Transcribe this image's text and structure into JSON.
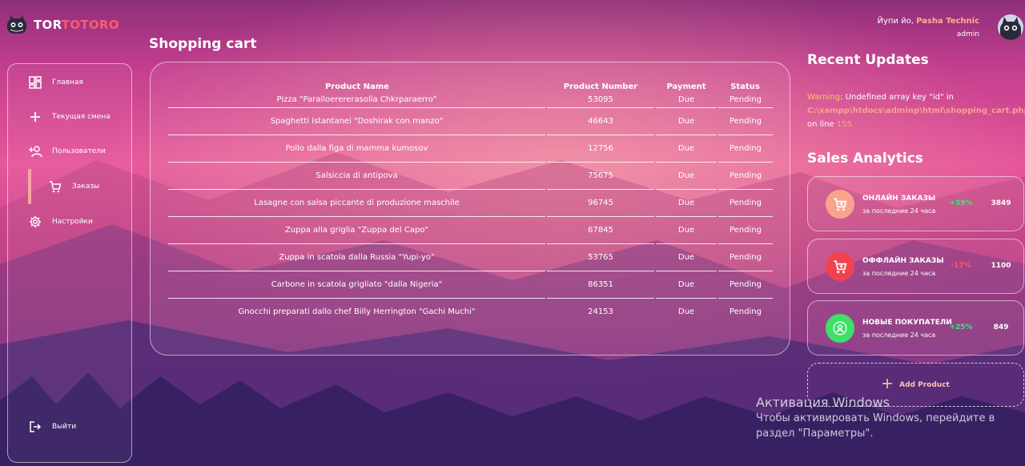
{
  "brand": {
    "part1": "TOR",
    "part2": "TOTORO"
  },
  "sidebar": {
    "items": [
      {
        "label": "Главная",
        "icon": "dashboard-icon"
      },
      {
        "label": "Текущая смена",
        "icon": "plus-icon"
      },
      {
        "label": "Пользователи",
        "icon": "person-add-icon"
      },
      {
        "label": "Заказы",
        "icon": "cart-icon",
        "active": true
      },
      {
        "label": "Настройки",
        "icon": "gear-icon"
      }
    ],
    "logout": "Выйти"
  },
  "main": {
    "title": "Shopping cart",
    "table": {
      "headers": [
        "Product Name",
        "Product Number",
        "Payment",
        "Status"
      ],
      "rows": [
        [
          "Pizza \"Paralloerererasolla Chkrparaerro\"",
          "53095",
          "Due",
          "Pending"
        ],
        [
          "Spaghetti istantanei \"Doshirak con manzo\"",
          "46643",
          "Due",
          "Pending"
        ],
        [
          "Pollo dalla figa di mamma kumosov",
          "12756",
          "Due",
          "Pending"
        ],
        [
          "Salsiccia di antipova",
          "75675",
          "Due",
          "Pending"
        ],
        [
          "Lasagne con salsa piccante di produzione maschile",
          "96745",
          "Due",
          "Pending"
        ],
        [
          "Zuppa alla griglia \"Zuppa del Capo\"",
          "67845",
          "Due",
          "Pending"
        ],
        [
          "Zuppa in scatola dalla Russia \"Yupi-yo\"",
          "53765",
          "Due",
          "Pending"
        ],
        [
          "Carbone in scatola grigliato \"dalla Nigeria\"",
          "86351",
          "Due",
          "Pending"
        ],
        [
          "Gnocchi preparati dallo chef Billy Herrington \"Gachi Muchi\"",
          "24153",
          "Due",
          "Pending"
        ]
      ]
    }
  },
  "header": {
    "greeting": "Йупи йо, ",
    "username": "Pasha Technic",
    "role": "admin"
  },
  "recent": {
    "title": "Recent Updates",
    "warning_label": "Warning",
    "warning_text": ": Undefined array key \"id\" in",
    "warning_path": "C:\\xampp\\htdocs\\adminp\\html\\shopping_cart.php",
    "on_line": "on line ",
    "line_number": "155"
  },
  "sales": {
    "title": "Sales Analytics",
    "cards": [
      {
        "title": "ОНЛАЙН ЗАКАЗЫ",
        "subtitle": "за последние 24 часа",
        "percent": "+39%",
        "value": "3849",
        "icon": "cart-icon",
        "icon_color": "#f7a48f",
        "percent_color": "#4ade80"
      },
      {
        "title": "ОФФЛАЙН ЗАКАЗЫ",
        "subtitle": "за последние 24 часа",
        "percent": "-17%",
        "value": "1100",
        "icon": "cart-icon",
        "icon_color": "#f0434f",
        "percent_color": "#ff5a6e"
      },
      {
        "title": "НОВЫЕ ПОКУПАТЕЛИ",
        "subtitle": "за последние 24 часа",
        "percent": "+25%",
        "value": "849",
        "icon": "person-icon",
        "icon_color": "#3ee06a",
        "percent_color": "#4ade80"
      }
    ],
    "add_product": "Add Product"
  },
  "activation": {
    "title": "Активация Windows",
    "text": "Чтобы активировать Windows, перейдите в раздел \"Параметры\"."
  }
}
